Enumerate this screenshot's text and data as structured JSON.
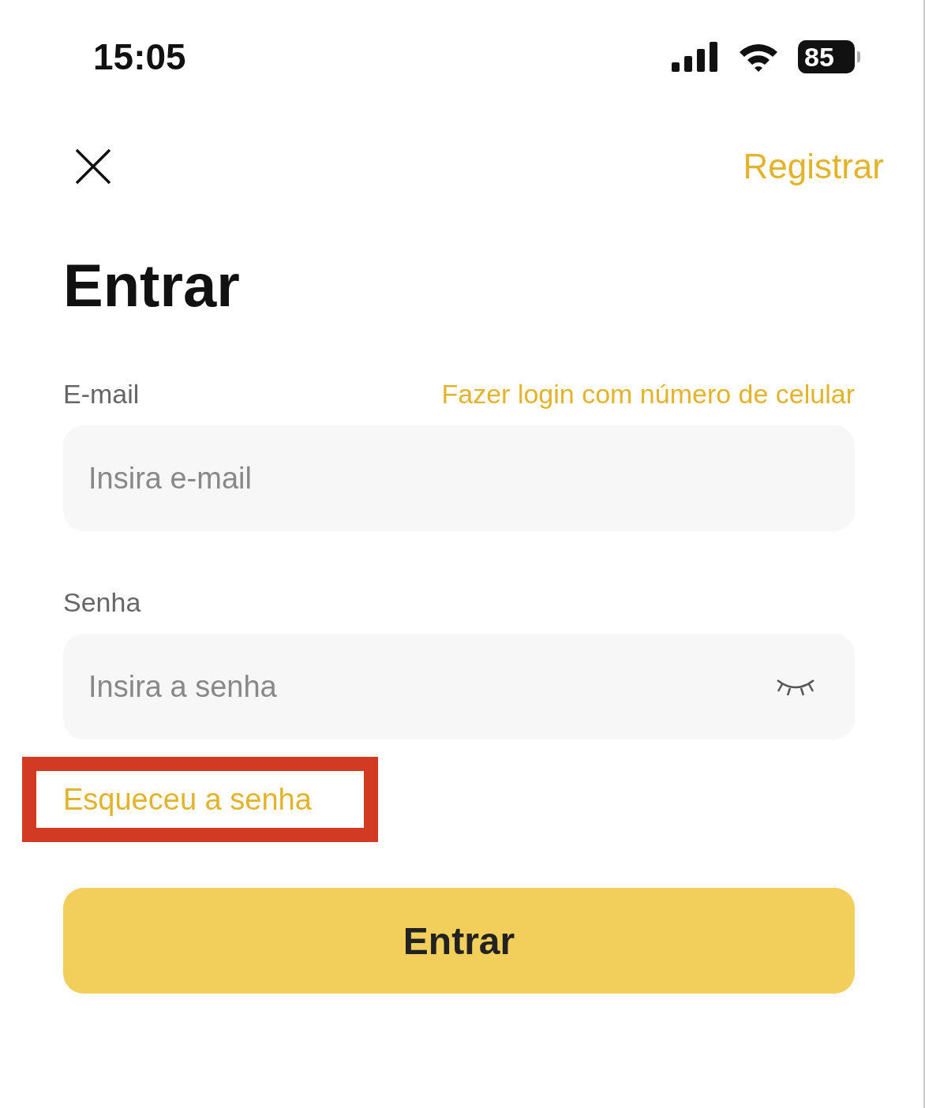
{
  "status_bar": {
    "time": "15:05",
    "battery": "85"
  },
  "header": {
    "action": "Registrar"
  },
  "title": "Entrar",
  "email": {
    "label": "E-mail",
    "switch_link": "Fazer login com número de celular",
    "placeholder": "Insira e-mail"
  },
  "password": {
    "label": "Senha",
    "placeholder": "Insira a senha",
    "visible": false
  },
  "forgot": {
    "label": "Esqueceu a senha",
    "highlighted": true
  },
  "submit": {
    "label": "Entrar"
  }
}
